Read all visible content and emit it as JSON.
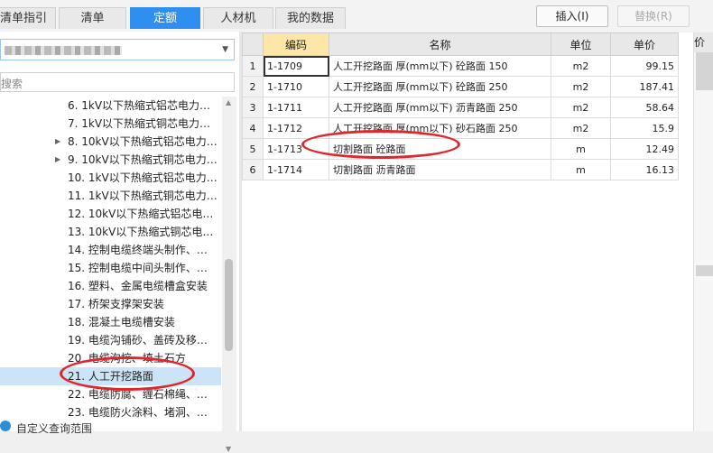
{
  "tabs": [
    {
      "label": "清单指引",
      "active": false
    },
    {
      "label": "清单",
      "active": false
    },
    {
      "label": "定额",
      "active": true
    },
    {
      "label": "人材机",
      "active": false
    },
    {
      "label": "我的数据",
      "active": false
    }
  ],
  "toolbar": {
    "insert_label": "插入(I)",
    "replace_label": "替换(R)"
  },
  "left": {
    "search_placeholder": "搜索",
    "tree_items": [
      {
        "label": "6.  1kV以下热缩式铝芯电力…",
        "expand": ""
      },
      {
        "label": "7.  1kV以下热缩式铜芯电力…",
        "expand": ""
      },
      {
        "label": "8.  10kV以下热缩式铝芯电力…",
        "expand": "▶"
      },
      {
        "label": "9.  10kV以下热缩式铜芯电力…",
        "expand": "▶"
      },
      {
        "label": "10.  1kV以下热缩式铝芯电力…",
        "expand": ""
      },
      {
        "label": "11.  1kV以下热缩式铜芯电力…",
        "expand": ""
      },
      {
        "label": "12.  10kV以下热缩式铝芯电…",
        "expand": ""
      },
      {
        "label": "13.  10kV以下热缩式铜芯电…",
        "expand": ""
      },
      {
        "label": "14.  控制电缆终端头制作、…",
        "expand": ""
      },
      {
        "label": "15.  控制电缆中间头制作、…",
        "expand": ""
      },
      {
        "label": "16.  塑料、金属电缆槽盒安装",
        "expand": ""
      },
      {
        "label": "17.  桥架支撑架安装",
        "expand": ""
      },
      {
        "label": "18.  混凝土电缆槽安装",
        "expand": ""
      },
      {
        "label": "19.  电缆沟铺砂、盖砖及移…",
        "expand": ""
      },
      {
        "label": "20.  电缆沟挖、填土石方",
        "expand": ""
      },
      {
        "label": "21.  人工开挖路面",
        "expand": "",
        "selected": true
      },
      {
        "label": "22.  电缆防腐、缠石棉绳、…",
        "expand": ""
      },
      {
        "label": "23.  电缆防火涂料、堵洞、…",
        "expand": ""
      }
    ],
    "bottom_link": "自定义查询范围"
  },
  "grid": {
    "headers": {
      "code": "编码",
      "name": "名称",
      "unit": "单位",
      "price": "单价"
    },
    "rows": [
      {
        "rn": "1",
        "code": "1-1709",
        "name": "人工开挖路面 厚(mm以下) 砼路面 150",
        "unit": "m2",
        "price": "99.15"
      },
      {
        "rn": "2",
        "code": "1-1710",
        "name": "人工开挖路面 厚(mm以下) 砼路面 250",
        "unit": "m2",
        "price": "187.41"
      },
      {
        "rn": "3",
        "code": "1-1711",
        "name": "人工开挖路面 厚(mm以下) 沥青路面 250",
        "unit": "m2",
        "price": "58.64"
      },
      {
        "rn": "4",
        "code": "1-1712",
        "name": "人工开挖路面 厚(mm以下) 砂石路面 250",
        "unit": "m2",
        "price": "15.9"
      },
      {
        "rn": "5",
        "code": "1-1713",
        "name": "切割路面 砼路面",
        "unit": "m",
        "price": "12.49"
      },
      {
        "rn": "6",
        "code": "1-1714",
        "name": "切割路面 沥青路面",
        "unit": "m",
        "price": "16.13"
      }
    ]
  },
  "right_strip": {
    "header": "价"
  },
  "colors": {
    "accent": "#2f8ff0",
    "annotation_red": "#e0262a",
    "code_header": "#fde6a6"
  }
}
